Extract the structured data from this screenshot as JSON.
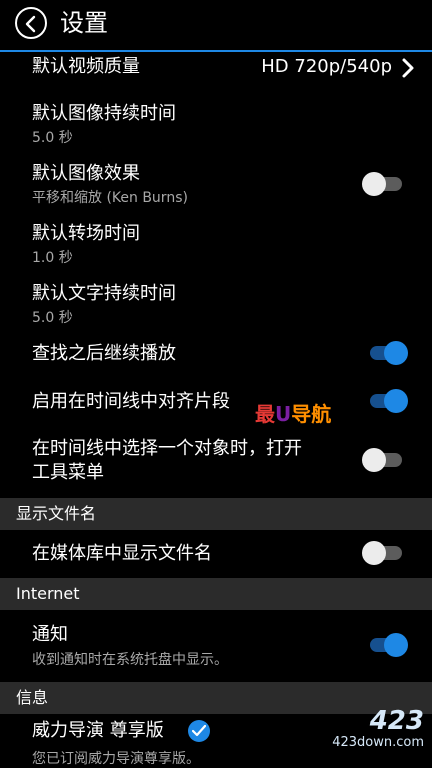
{
  "header": {
    "title": "设置",
    "back_icon": "chevron-left-icon"
  },
  "items": [
    {
      "label": "默认视频质量",
      "value": "HD 720p/540p"
    },
    {
      "label": "默认图像持续时间",
      "sub": "5.0 秒"
    },
    {
      "label": "默认图像效果",
      "sub": "平移和缩放 (Ken Burns)",
      "toggle": "off"
    },
    {
      "label": "默认转场时间",
      "sub": "1.0 秒"
    },
    {
      "label": "默认文字持续时间",
      "sub": "5.0 秒"
    },
    {
      "label": "查找之后继续播放",
      "toggle": "on"
    },
    {
      "label": "启用在时间线中对齐片段",
      "toggle": "on"
    },
    {
      "label_line1": "在时间线中选择一个对象时，打开",
      "label_line2": "工具菜单",
      "toggle": "off"
    }
  ],
  "sections": {
    "filename": {
      "header": "显示文件名",
      "items": [
        {
          "label": "在媒体库中显示文件名",
          "toggle": "off"
        }
      ]
    },
    "internet": {
      "header": "Internet",
      "items": [
        {
          "label": "通知",
          "sub": "收到通知时在系统托盘中显示。",
          "toggle": "on"
        }
      ]
    },
    "info": {
      "header": "信息",
      "items": [
        {
          "label": "威力导演 尊享版",
          "sub": "您已订阅威力导演尊享版。",
          "badge": "check-badge-icon"
        }
      ]
    }
  },
  "watermarks": {
    "center": {
      "c1": "最",
      "c2": "U",
      "c3": "导航"
    },
    "corner": {
      "line1": "423",
      "line2": "423down.com"
    }
  },
  "colors": {
    "accent": "#1e88e5",
    "section_bg": "#2b2b2b",
    "toggle_on_track": "#16508f"
  }
}
